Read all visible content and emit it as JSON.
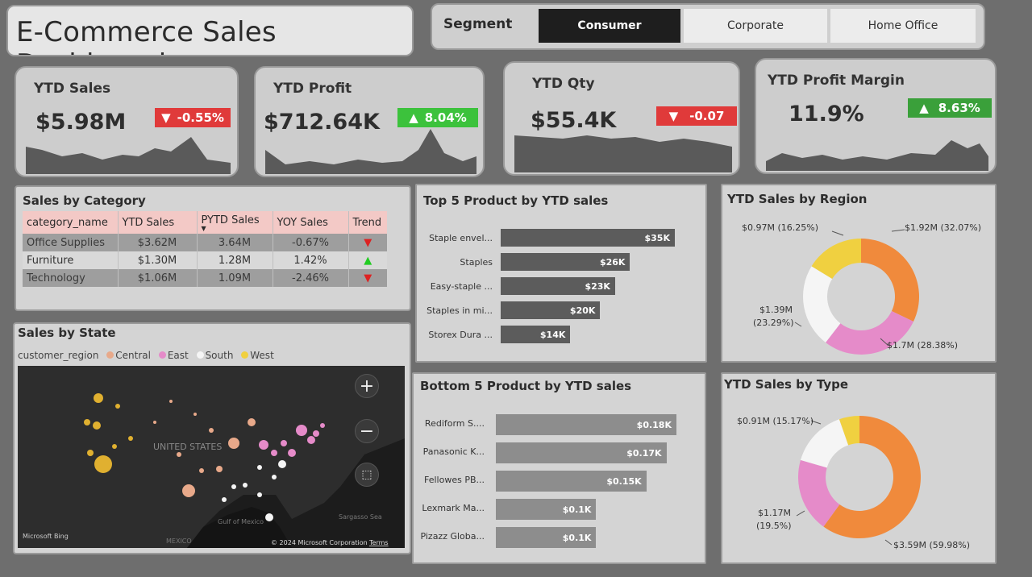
{
  "header": {
    "title": "E-Commerce Sales Dashboard"
  },
  "segment": {
    "label": "Segment",
    "options": [
      "Consumer",
      "Corporate",
      "Home Office"
    ],
    "selected": "Consumer"
  },
  "kpis": [
    {
      "title": "YTD Sales",
      "value": "$5.98M",
      "change": "-0.55%",
      "direction": "down",
      "color": "#e03a3a"
    },
    {
      "title": "YTD Profit",
      "value": "$712.64K",
      "change": "8.04%",
      "direction": "up",
      "color": "#3cc23c"
    },
    {
      "title": "YTD Qty",
      "value": "$55.4K",
      "change": "-0.07",
      "direction": "down",
      "color": "#e03a3a"
    },
    {
      "title": "YTD Profit Margin",
      "value": "11.9%",
      "change": "8.63%",
      "direction": "up",
      "color": "#3cc23c"
    }
  ],
  "category": {
    "title": "Sales by Category",
    "columns": [
      "category_name",
      "YTD Sales",
      "PYTD Sales",
      "YOY Sales",
      "Trend"
    ],
    "rows": [
      {
        "name": "Office Supplies",
        "ytd": "$3.62M",
        "pytd": "3.64M",
        "yoy": "-0.67%",
        "trend": "down"
      },
      {
        "name": "Furniture",
        "ytd": "$1.30M",
        "pytd": "1.28M",
        "yoy": "1.42%",
        "trend": "up"
      },
      {
        "name": "Technology",
        "ytd": "$1.06M",
        "pytd": "1.09M",
        "yoy": "-2.46%",
        "trend": "down"
      }
    ]
  },
  "top5": {
    "title": "Top 5 Product by YTD sales",
    "items": [
      {
        "label": "Staple envel...",
        "value": 35,
        "text": "$35K"
      },
      {
        "label": "Staples",
        "value": 26,
        "text": "$26K"
      },
      {
        "label": "Easy-staple ...",
        "value": 23,
        "text": "$23K"
      },
      {
        "label": "Staples in mi...",
        "value": 20,
        "text": "$20K"
      },
      {
        "label": "Storex Dura ...",
        "value": 14,
        "text": "$14K"
      }
    ]
  },
  "bottom5": {
    "title": "Bottom 5 Product by YTD sales",
    "items": [
      {
        "label": "Rediform S....",
        "value": 0.18,
        "text": "$0.18K"
      },
      {
        "label": "Panasonic K...",
        "value": 0.17,
        "text": "$0.17K"
      },
      {
        "label": "Fellowes PB...",
        "value": 0.15,
        "text": "$0.15K"
      },
      {
        "label": "Lexmark Ma...",
        "value": 0.1,
        "text": "$0.1K"
      },
      {
        "label": "Pizazz Globa...",
        "value": 0.1,
        "text": "$0.1K"
      }
    ]
  },
  "region": {
    "title": "YTD Sales by Region",
    "slices": [
      {
        "value": 32.07,
        "color": "#f08a3c",
        "label": "$1.92M (32.07%)"
      },
      {
        "value": 28.38,
        "color": "#e58bc9",
        "label": "$1.7M (28.38%)"
      },
      {
        "value": 23.29,
        "color": "#f5f5f5",
        "label": "$1.39M (23.29%)"
      },
      {
        "value": 16.25,
        "color": "#f0d040",
        "label": "$0.97M (16.25%)"
      }
    ],
    "label_a": "$1.39M",
    "label_b": "(23.29%)"
  },
  "type": {
    "title": "YTD Sales by Type",
    "slices": [
      {
        "value": 59.98,
        "color": "#f08a3c",
        "label": "$3.59M (59.98%)"
      },
      {
        "value": 19.5,
        "color": "#e58bc9",
        "label": "$1.17M (19.5%)"
      },
      {
        "value": 15.17,
        "color": "#f5f5f5",
        "label": "$0.91M (15.17%)"
      },
      {
        "value": 5.35,
        "color": "#f0d040",
        "label": ""
      }
    ],
    "label_a": "$1.17M",
    "label_b": "(19.5%)"
  },
  "state": {
    "title": "Sales by State",
    "legend_label": "customer_region",
    "legend": [
      {
        "name": "Central",
        "color": "#e8a98a"
      },
      {
        "name": "East",
        "color": "#e58bc9"
      },
      {
        "name": "South",
        "color": "#f5f5f5"
      },
      {
        "name": "West",
        "color": "#f0d040"
      }
    ],
    "map_text": {
      "country": "UNITED STATES",
      "gulf": "Gulf of Mexico",
      "sea": "Sargasso Sea",
      "mexico": "MEXICO",
      "bing": "Microsoft Bing",
      "copyright": "© 2024 Microsoft Corporation",
      "terms": "Terms"
    }
  }
}
